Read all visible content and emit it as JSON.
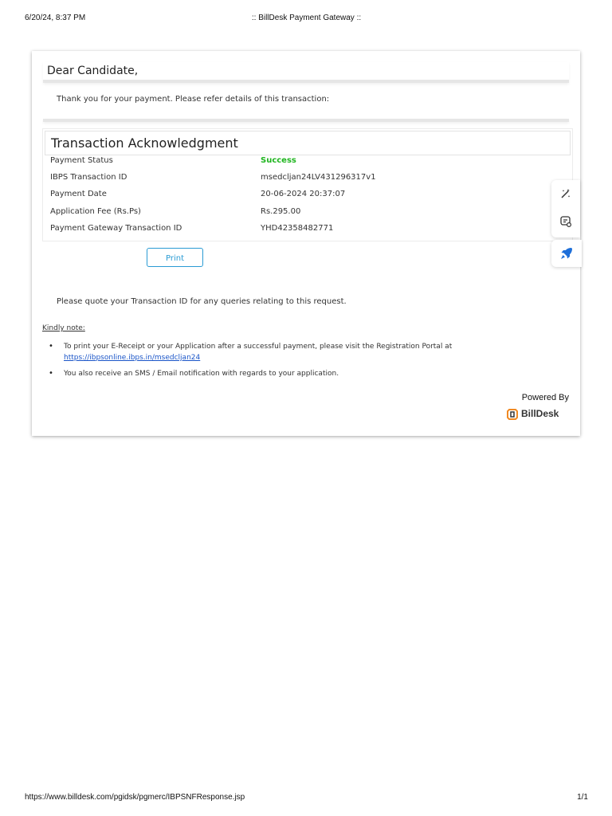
{
  "print_header": {
    "datetime": "6/20/24, 8:37 PM",
    "page_title": ":: BillDesk Payment Gateway ::"
  },
  "greeting": "Dear Candidate,",
  "intro_text": "Thank you for your payment. Please refer details of this transaction:",
  "acknowledgment": {
    "title": "Transaction Acknowledgment",
    "rows": [
      {
        "label": "Payment Status",
        "value": "Success"
      },
      {
        "label": "IBPS Transaction ID",
        "value": "msedcljan24LV431296317v1"
      },
      {
        "label": "Payment Date",
        "value": "20-06-2024 20:37:07"
      },
      {
        "label": "Application Fee (Rs.Ps)",
        "value": "Rs.295.00"
      },
      {
        "label": "Payment Gateway Transaction ID",
        "value": "YHD42358482771"
      }
    ]
  },
  "print_button_label": "Print",
  "quote_text": "Please quote your Transaction ID for any queries relating to this request.",
  "kindly_note_label": "Kindly note:",
  "notes": {
    "note1_text": "To print your E-Receipt or your Application after a successful payment, please visit the Registration Portal at",
    "note1_link": "https://ibpsonline.ibps.in/msedcljan24",
    "note2_text": "You also receive an SMS / Email notification with regards to your application."
  },
  "powered_by": "Powered By",
  "brand_name": "BillDesk",
  "print_footer": {
    "url": "https://www.billdesk.com/pgidsk/pgmerc/IBPSNFResponse.jsp",
    "page_number": "1/1"
  },
  "colors": {
    "success": "#1fb51f",
    "link": "#1a55c8",
    "button_accent": "#2a9bd4",
    "side_accent": "#1e6fd9",
    "brand_orange": "#f08a24"
  },
  "side_icons": [
    "magic-wand-icon",
    "chat-settings-icon",
    "rocket-icon"
  ]
}
